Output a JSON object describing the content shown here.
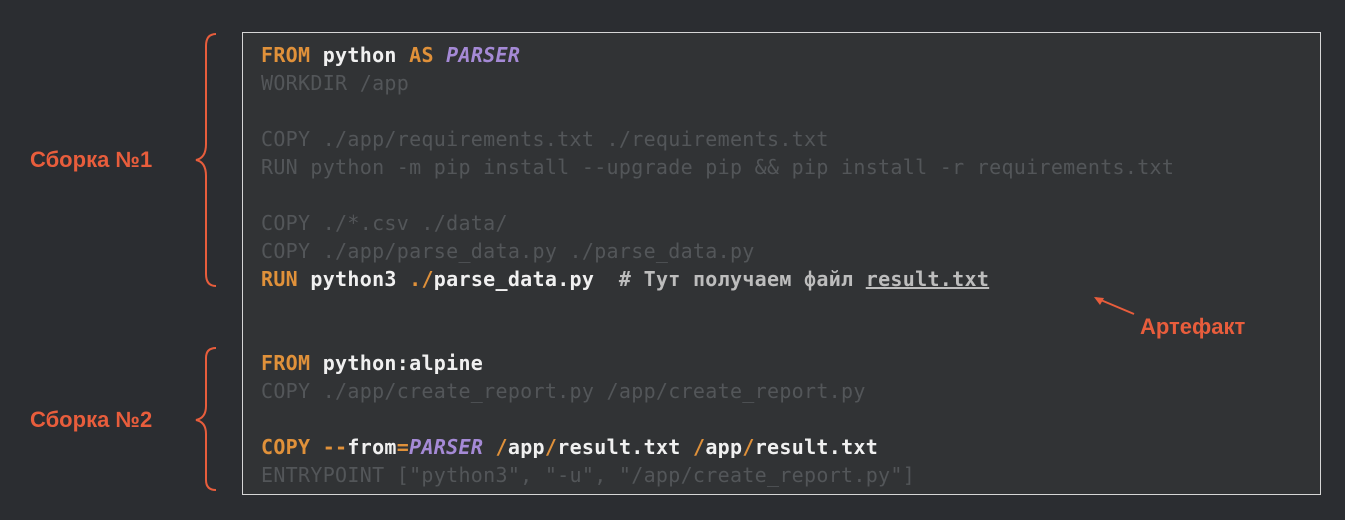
{
  "labels": {
    "stage1": "Сборка №1",
    "stage2": "Сборка №2",
    "artifact": "Артефакт"
  },
  "colors": {
    "accent": "#e85d3c",
    "keyword": "#e0913a",
    "alias": "#a58ad6",
    "dimmed": "#535659",
    "background": "#2b2d31"
  },
  "code": {
    "l1": {
      "kw": "FROM",
      "a": " python ",
      "kw2": "AS",
      "sp": " ",
      "alias": "PARSER"
    },
    "l2": "WORKDIR /app",
    "l3": "COPY ./app/requirements.txt ./requirements.txt",
    "l4": "RUN python -m pip install --upgrade pip && pip install -r requirements.txt",
    "l5": "COPY ./*.csv ./data/",
    "l6": "COPY ./app/parse_data.py ./parse_data.py",
    "l7": {
      "kw": "RUN",
      "a": " python3 ",
      "dot": ".",
      "slash": "/",
      "rest": "parse_data.py  ",
      "comment": "# Тут получаем файл ",
      "file": "result.txt"
    },
    "l8": {
      "kw": "FROM",
      "a": " python:alpine"
    },
    "l9": "COPY ./app/create_report.py /app/create_report.py",
    "l10": {
      "kw": "COPY",
      "sp1": " ",
      "dashes": "--",
      "from": "from",
      "eq": "=",
      "alias": "PARSER",
      "sp2": " ",
      "s1": "/",
      "p1": "app",
      "s2": "/",
      "p2": "result.txt ",
      "s3": "/",
      "p3": "app",
      "s4": "/",
      "p4": "result.txt"
    },
    "l11": "ENTRYPOINT [\"python3\", \"-u\", \"/app/create_report.py\"]"
  }
}
